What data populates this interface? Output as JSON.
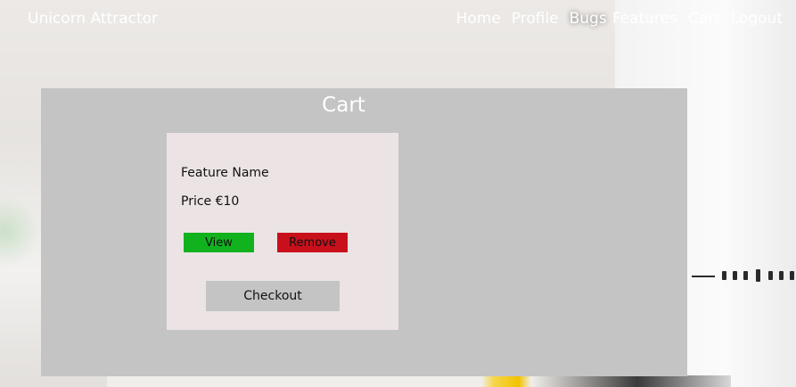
{
  "navbar": {
    "brand": "Unicorn Attractor",
    "links": [
      "Home",
      "Profile",
      "Bugs",
      "Features",
      "Cart",
      "Logout"
    ]
  },
  "cart": {
    "title": "Cart",
    "items": [
      {
        "name": "Feature Name",
        "price_label": "Price",
        "price": "€10",
        "view_label": "View",
        "remove_label": "Remove"
      }
    ],
    "checkout_label": "Checkout"
  },
  "colors": {
    "panel": "#c4c4c4",
    "card": "#ece4e4",
    "view_button": "#12b21f",
    "remove_button": "#c8101c",
    "checkout_button": "#c4c4c4"
  }
}
